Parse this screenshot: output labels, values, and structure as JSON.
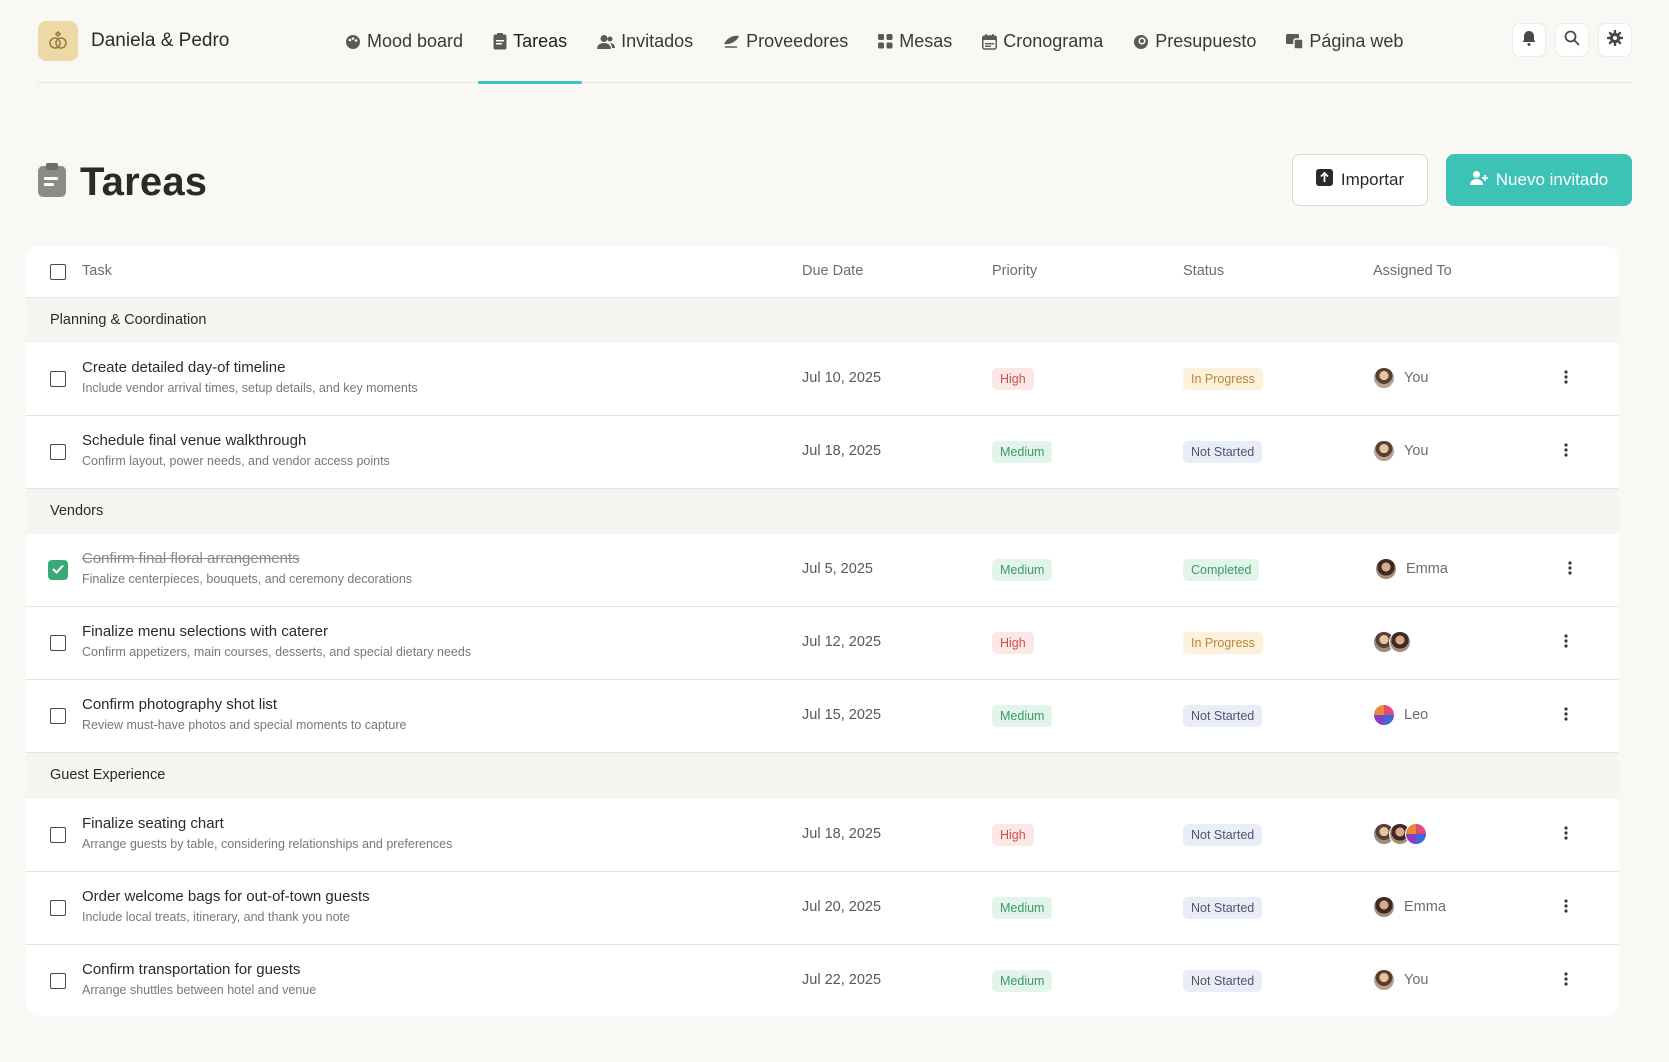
{
  "brand": {
    "name": "Daniela & Pedro"
  },
  "nav": {
    "items": [
      {
        "label": "Mood board",
        "icon": "palette-icon"
      },
      {
        "label": "Tareas",
        "icon": "clipboard-icon",
        "active": true
      },
      {
        "label": "Invitados",
        "icon": "users-icon"
      },
      {
        "label": "Proveedores",
        "icon": "vendor-icon"
      },
      {
        "label": "Mesas",
        "icon": "grid-icon"
      },
      {
        "label": "Cronograma",
        "icon": "calendar-icon"
      },
      {
        "label": "Presupuesto",
        "icon": "coin-icon"
      },
      {
        "label": "Página web",
        "icon": "web-icon"
      }
    ]
  },
  "header": {
    "title": "Tareas",
    "import_label": "Importar",
    "new_label": "Nuevo invitado"
  },
  "table": {
    "columns": {
      "task": "Task",
      "due": "Due Date",
      "priority": "Priority",
      "status": "Status",
      "assigned": "Assigned To"
    },
    "sections": [
      {
        "label": "Planning & Coordination",
        "tasks": [
          {
            "title": "Create detailed day-of timeline",
            "desc": "Include vendor arrival times, setup details, and key moments",
            "due": "Jul 10, 2025",
            "priority": "High",
            "status": "In Progress",
            "assignee": "You",
            "done": false
          },
          {
            "title": "Schedule final venue walkthrough",
            "desc": "Confirm layout, power needs, and vendor access points",
            "due": "Jul 18, 2025",
            "priority": "Medium",
            "status": "Not Started",
            "assignee": "You",
            "done": false
          }
        ]
      },
      {
        "label": "Vendors",
        "tasks": [
          {
            "title": "Confirm final floral arrangements",
            "desc": "Finalize centerpieces, bouquets, and ceremony decorations",
            "due": "Jul 5, 2025",
            "priority": "Medium",
            "status": "Completed",
            "assignee": "Emma",
            "done": true
          },
          {
            "title": "Finalize menu selections with caterer",
            "desc": "Confirm appetizers, main courses, desserts, and special dietary needs",
            "due": "Jul 12, 2025",
            "priority": "High",
            "status": "In Progress",
            "assignee": "",
            "done": false
          },
          {
            "title": "Confirm photography shot list",
            "desc": "Review must-have photos and special moments to capture",
            "due": "Jul 15, 2025",
            "priority": "Medium",
            "status": "Not Started",
            "assignee": "Leo",
            "done": false
          }
        ]
      },
      {
        "label": "Guest Experience",
        "tasks": [
          {
            "title": "Finalize seating chart",
            "desc": "Arrange guests by table, considering relationships and preferences",
            "due": "Jul 18, 2025",
            "priority": "High",
            "status": "Not Started",
            "assignee": "",
            "done": false
          },
          {
            "title": "Order welcome bags for out-of-town guests",
            "desc": "Include local treats, itinerary, and thank you note",
            "due": "Jul 20, 2025",
            "priority": "Medium",
            "status": "Not Started",
            "assignee": "Emma",
            "done": false
          },
          {
            "title": "Confirm transportation for guests",
            "desc": "Arrange shuttles between hotel and venue",
            "due": "Jul 22, 2025",
            "priority": "Medium",
            "status": "Not Started",
            "assignee": "You",
            "done": false
          }
        ]
      }
    ]
  },
  "colors": {
    "accent": "#3cc3b5",
    "completed_check": "#3aa877",
    "background": "#f9f8f5"
  }
}
